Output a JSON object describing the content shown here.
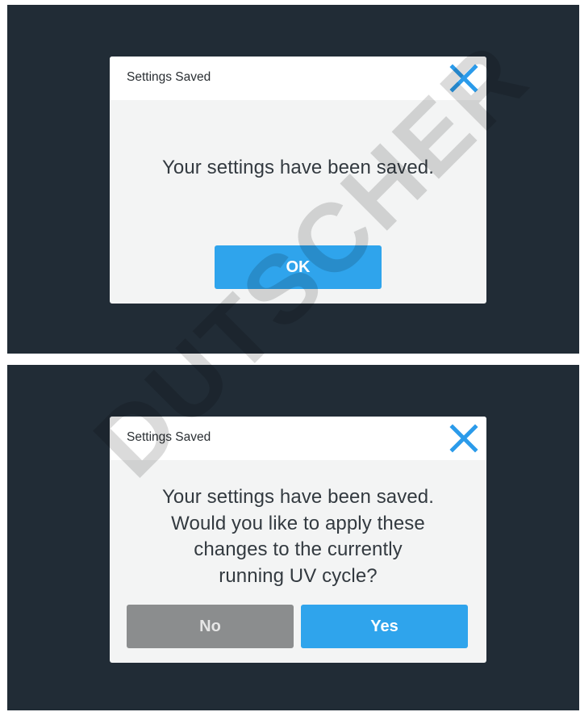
{
  "dialog_saved": {
    "title": "Settings Saved",
    "close_icon": "close-icon",
    "message": "Your settings have been saved.",
    "ok_label": "OK"
  },
  "dialog_apply": {
    "title": "Settings Saved",
    "close_icon": "close-icon",
    "message_lines": [
      "Your settings have been saved.",
      "Would you like to apply these",
      "changes to the currently",
      "running UV cycle?"
    ],
    "no_label": "No",
    "yes_label": "Yes"
  },
  "watermark": "DUTSCHER",
  "colors": {
    "background": "#212c36",
    "accent": "#2fa4ec",
    "secondary_button": "#8b8d8e",
    "dialog_body": "#f3f4f4"
  }
}
